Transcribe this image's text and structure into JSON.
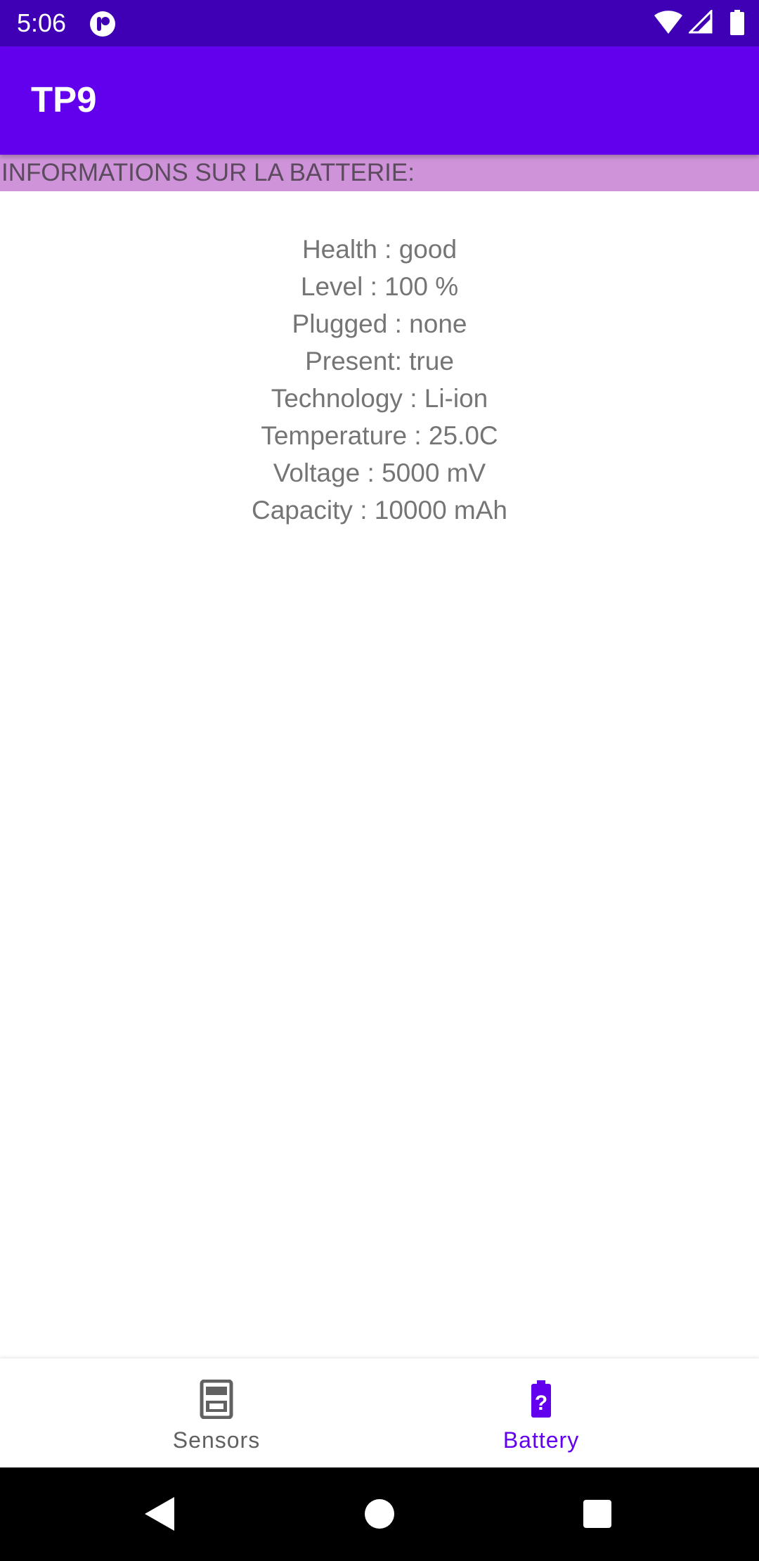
{
  "status_bar": {
    "time": "5:06",
    "icons": [
      "app-notification-icon",
      "wifi-icon",
      "cellular-signal-icon",
      "battery-full-icon"
    ]
  },
  "app_bar": {
    "title": "TP9",
    "background": "#6200EE"
  },
  "section_header": {
    "text": "INFORMATIONS SUR LA BATTERIE:",
    "background": "#CE93D8"
  },
  "battery_info": [
    "Health : good",
    "Level : 100 %",
    "Plugged : none",
    "Present: true",
    "Technology : Li-ion",
    "Temperature : 25.0C",
    "Voltage : 5000 mV",
    "Capacity : 10000 mAh"
  ],
  "bottom_nav": {
    "items": [
      {
        "label": "Sensors",
        "icon": "sensors-icon",
        "selected": false
      },
      {
        "label": "Battery",
        "icon": "battery-unknown-icon",
        "selected": true
      }
    ],
    "accent": "#6200EE"
  },
  "system_nav": {
    "icons": [
      "back-icon",
      "home-icon",
      "recents-icon"
    ]
  }
}
